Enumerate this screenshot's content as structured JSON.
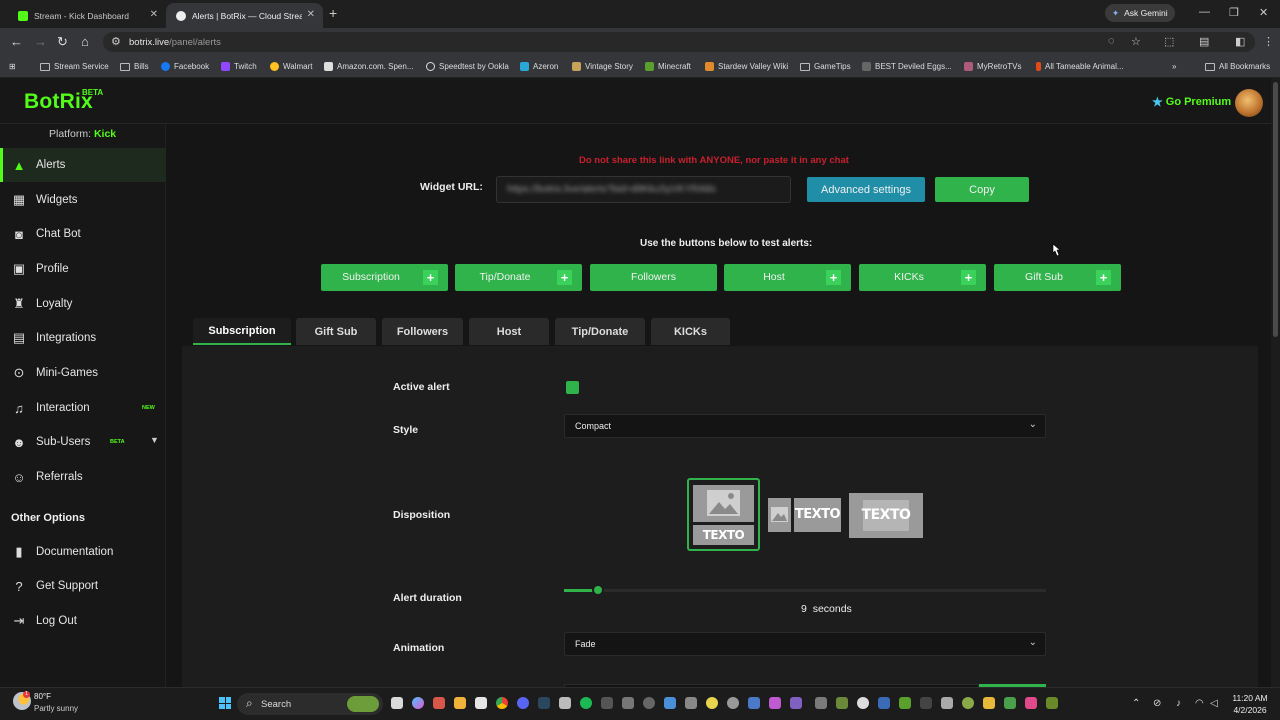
{
  "browser": {
    "tabs": [
      {
        "title": "Stream - Kick Dashboard",
        "active": false
      },
      {
        "title": "Alerts | BotRix — Cloud Stream",
        "active": true
      }
    ],
    "ask_gemini": "Ask Gemini",
    "url_host": "botrix.live",
    "url_path": "/panel/alerts",
    "bookmarks": [
      "Stream Service",
      "Bills",
      "Facebook",
      "Twitch",
      "Walmart",
      "Amazon.com. Spen...",
      "Speedtest by Ookla",
      "Azeron",
      "Vintage Story",
      "Minecraft",
      "Stardew Valley Wiki",
      "GameTips",
      "BEST Deviled Eggs...",
      "MyRetroTVs",
      "All Tameable Animal..."
    ],
    "all_bookmarks": "All Bookmarks"
  },
  "header": {
    "logo": "BotRix",
    "logo_badge": "BETA",
    "premium": "Go Premium"
  },
  "sidebar": {
    "platform_label": "Platform:",
    "platform_value": "Kick",
    "items": [
      {
        "label": "Alerts",
        "icon": "warning-triangle-icon",
        "active": true
      },
      {
        "label": "Widgets",
        "icon": "grid-icon"
      },
      {
        "label": "Chat Bot",
        "icon": "robot-icon"
      },
      {
        "label": "Profile",
        "icon": "id-card-icon"
      },
      {
        "label": "Loyalty",
        "icon": "trophy-icon"
      },
      {
        "label": "Integrations",
        "icon": "plug-icon"
      },
      {
        "label": "Mini-Games",
        "icon": "gamepad-icon"
      },
      {
        "label": "Interaction",
        "icon": "music-note-icon",
        "badge": "NEW"
      },
      {
        "label": "Sub-Users",
        "icon": "users-icon",
        "badge": "BETA"
      },
      {
        "label": "Referrals",
        "icon": "user-plus-icon"
      }
    ],
    "other_heading": "Other Options",
    "other_items": [
      {
        "label": "Documentation",
        "icon": "book-icon"
      },
      {
        "label": "Get Support",
        "icon": "question-icon"
      },
      {
        "label": "Log Out",
        "icon": "logout-icon"
      }
    ]
  },
  "main": {
    "warning": "Do not share this link with ANYONE, nor paste it in any chat",
    "widget_url_label": "Widget URL:",
    "widget_url_value": "https://botrix.live/alerts?bid=d9KkuSyVKYRA8s",
    "advanced_settings": "Advanced settings",
    "copy": "Copy",
    "test_label": "Use the buttons below to test alerts:",
    "test_buttons": [
      {
        "label": "Subscription",
        "plus": true
      },
      {
        "label": "Tip/Donate",
        "plus": true
      },
      {
        "label": "Followers",
        "plus": false
      },
      {
        "label": "Host",
        "plus": true
      },
      {
        "label": "KICKs",
        "plus": true
      },
      {
        "label": "Gift Sub",
        "plus": true
      }
    ],
    "tabs": [
      "Subscription",
      "Gift Sub",
      "Followers",
      "Host",
      "Tip/Donate",
      "KICKs"
    ],
    "active_tab": "Subscription",
    "form": {
      "active_alert_label": "Active alert",
      "active_alert_checked": true,
      "style_label": "Style",
      "style_value": "Compact",
      "disposition_label": "Disposition",
      "disposition_text": "TEXTO",
      "alert_duration_label": "Alert duration",
      "alert_duration_value": "9",
      "alert_duration_unit": "seconds",
      "alert_duration_fraction": 0.07,
      "animation_label": "Animation",
      "animation_value": "Fade"
    }
  },
  "taskbar": {
    "temperature": "80°F",
    "condition": "Partly sunny",
    "search": "Search",
    "time": "11:20 AM",
    "date": "4/2/2026"
  },
  "colors": {
    "brand_green": "#53fc18",
    "button_green": "#2fb34a",
    "advanced_blue": "#1f8ea6",
    "warning_red": "#c8202f"
  }
}
